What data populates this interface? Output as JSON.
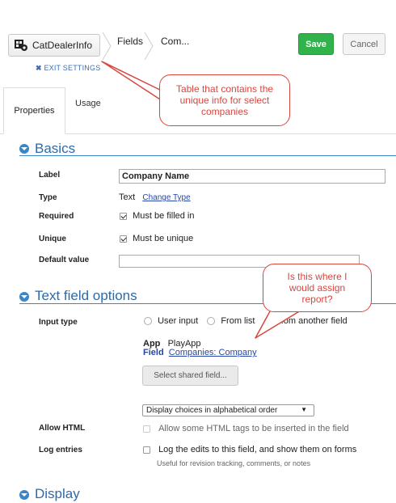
{
  "header": {
    "table_button_label": "CatDealerInfo",
    "breadcrumb": [
      "Fields",
      "Com..."
    ],
    "exit_settings": "EXIT SETTINGS",
    "save_label": "Save",
    "cancel_label": "Cancel"
  },
  "tabs": [
    {
      "label": "Properties",
      "active": true
    },
    {
      "label": "Usage",
      "active": false
    }
  ],
  "callouts": {
    "table": "Table that contains the unique info for select companies",
    "report": "Is this where I would assign report?"
  },
  "basics": {
    "title": "Basics",
    "label_label": "Label",
    "label_value": "Company Name",
    "type_label": "Type",
    "type_value": "Text",
    "change_type_link": "Change Type",
    "required_label": "Required",
    "required_text": "Must be filled in",
    "required_checked": true,
    "unique_label": "Unique",
    "unique_text": "Must be unique",
    "unique_checked": true,
    "default_label": "Default value",
    "default_value": ""
  },
  "text_options": {
    "title": "Text field options",
    "input_type_label": "Input type",
    "radio_user_input": "User input",
    "radio_from_list": "From list",
    "radio_another_field": "...om another field",
    "app_label": "App",
    "app_value": "PlayApp",
    "field_label": "Field",
    "field_value": "Companies: Company",
    "select_shared_button": "Select shared field...",
    "display_choices": "Display choices in alphabetical order",
    "allow_html_label": "Allow HTML",
    "allow_html_text": "Allow some HTML tags to be inserted in the field",
    "log_entries_label": "Log entries",
    "log_entries_text": "Log the edits to this field, and show them on forms",
    "log_entries_hint": "Useful for revision tracking, comments, or notes"
  },
  "display": {
    "title": "Display"
  },
  "colors": {
    "accent": "#3a86c8",
    "save": "#2fb34a",
    "callout": "#d9463f"
  }
}
